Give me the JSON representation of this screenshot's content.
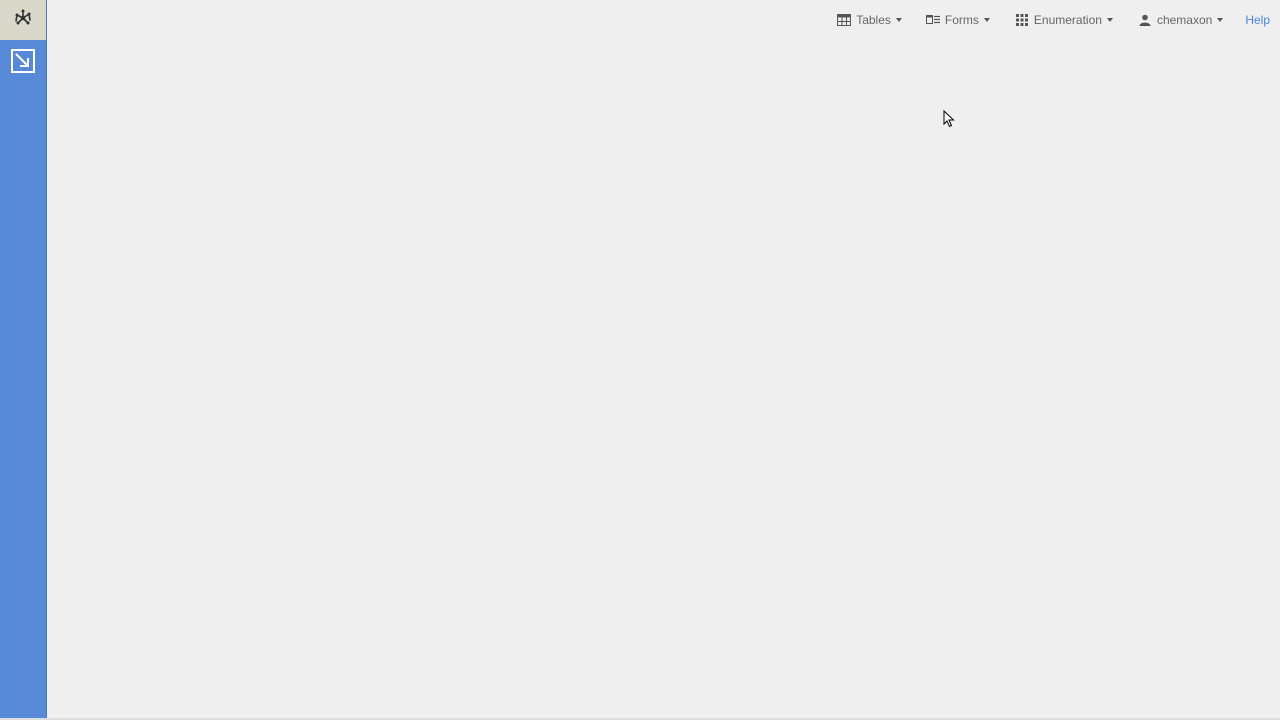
{
  "sidebar": {
    "logo_icon": "molecule-logo-icon",
    "expand_icon": "expand-arrow-icon",
    "colors": {
      "sidebar_bg": "#5889d6",
      "logo_bg": "#d8d7c9"
    }
  },
  "topnav": {
    "items": [
      {
        "label": "Tables",
        "icon": "table-grid-icon"
      },
      {
        "label": "Forms",
        "icon": "form-icon"
      },
      {
        "label": "Enumeration",
        "icon": "apps-grid-icon"
      },
      {
        "label": "chemaxon",
        "icon": "user-icon"
      }
    ],
    "help_label": "Help",
    "colors": {
      "text": "#666666",
      "link": "#4a86d8"
    }
  },
  "main": {
    "background": "#efefef"
  }
}
